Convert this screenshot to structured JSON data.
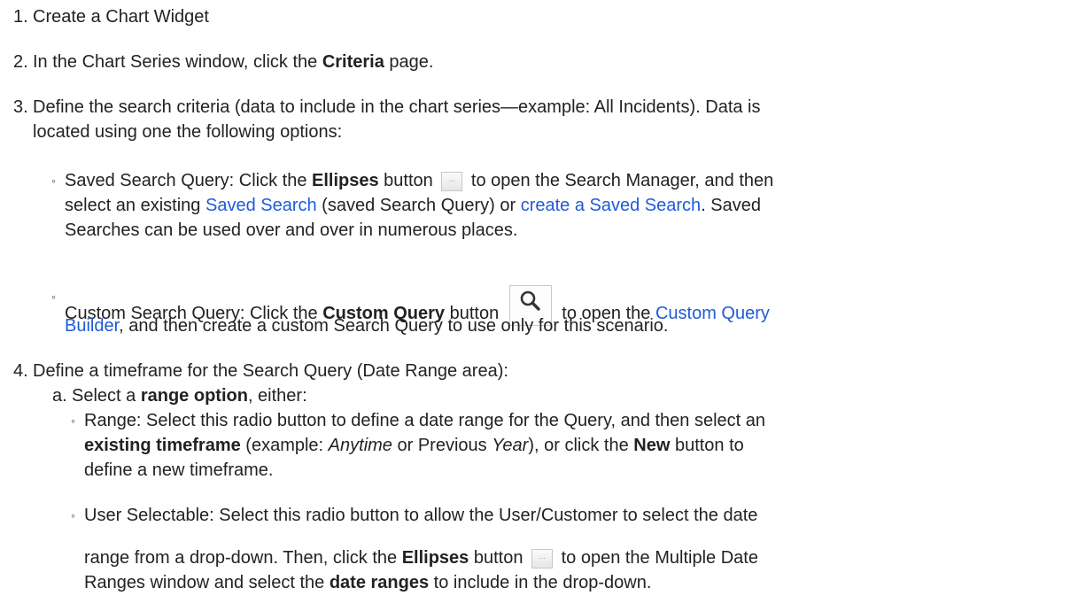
{
  "steps": {
    "s1": {
      "num": "1.",
      "text": "Create a Chart Widget"
    },
    "s2": {
      "num": "2.",
      "pre": "In the Chart Series window, click the ",
      "bold": "Criteria",
      "post": " page."
    },
    "s3": {
      "num": "3.",
      "line1": "Define the search criteria (data to include in the chart series—example: All Incidents). Data is",
      "line2": "located using one the following options:",
      "saved": {
        "bullet": "◦",
        "pre": "Saved Search Query: Click the ",
        "bold": "Ellipses",
        "mid": " button ",
        "post": " to open the Search Manager, and then",
        "l2_pre": "select an existing ",
        "link1": "Saved Search",
        "l2_mid": " (saved Search Query) or ",
        "link2": "create a Saved Search",
        "l2_post": ". Saved",
        "l3": "Searches can be used over and over in numerous places."
      },
      "custom": {
        "bullet": "◦",
        "pre": "Custom Search Query: Click the ",
        "bold": "Custom Query",
        "mid": " button ",
        "post": " to open the ",
        "link": "Custom Query",
        "l2_link": "Builder",
        "l2_post": ", and then create a custom Search Query to use only for this scenario."
      }
    },
    "s4": {
      "num": "4.",
      "text": "Define a timeframe for the Search Query (Date Range area):",
      "a": {
        "letter": "a.",
        "pre": "Select a ",
        "bold": "range option",
        "post": ", either:",
        "range": {
          "bullet": "◦",
          "l1": "Range: Select this radio button to define a date range for the Query, and then select an",
          "bold1": "existing timeframe",
          "l2_a": " (example: ",
          "ital1": "Anytime",
          "l2_b": " or Previous ",
          "ital2": "Year",
          "l2_c": "), or click the ",
          "bold2": "New",
          "l2_d": " button to",
          "l3": "define a new timeframe."
        },
        "user": {
          "bullet": "◦",
          "l1": "User Selectable: Select this radio button to allow the User/Customer to select the date",
          "l2_a": "range from a drop-down. Then, click the ",
          "bold1": "Ellipses",
          "l2_b": " button ",
          "l2_c": " to open the Multiple Date",
          "l3_a": "Ranges window and select the ",
          "bold2": "date ranges",
          "l3_b": " to include in the drop-down."
        }
      }
    }
  }
}
